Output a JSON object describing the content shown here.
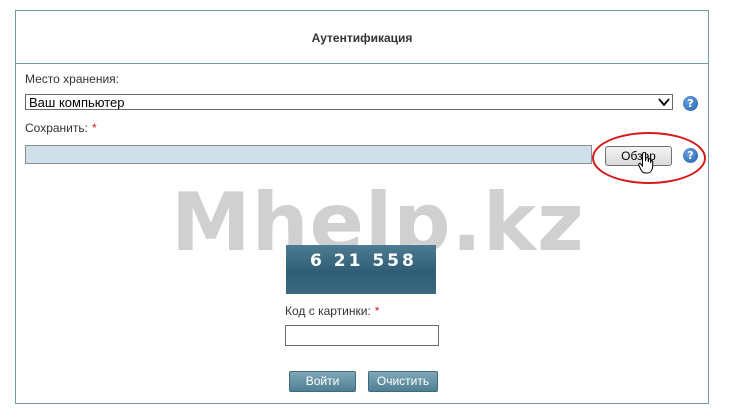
{
  "header": {
    "title": "Аутентификация"
  },
  "storage": {
    "label": "Место хранения:",
    "selected": "Ваш компьютер",
    "help": "?"
  },
  "save": {
    "label": "Сохранить:",
    "required_mark": "*",
    "browse_label": "Обзор",
    "help": "?"
  },
  "watermark": "Mhelp.kz",
  "captcha": {
    "text": "6 21 558"
  },
  "code": {
    "label": "Код с картинки:",
    "required_mark": "*",
    "value": ""
  },
  "actions": {
    "login_label": "Войти",
    "clear_label": "Очистить"
  },
  "colors": {
    "border": "#6f9aa9",
    "required": "#cc2222",
    "highlight_ellipse": "#d61a1a",
    "button": "#5f8ea2"
  }
}
